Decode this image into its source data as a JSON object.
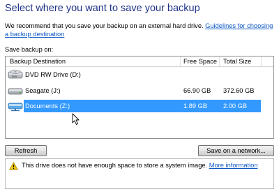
{
  "header": {
    "title": "Select where you want to save your backup",
    "intro_text": "We recommend that you save your backup on an external hard drive. ",
    "guidelines_link": "Guidelines for choosing a backup destination"
  },
  "save_label": "Save backup on:",
  "columns": {
    "destination": "Backup Destination",
    "free_space": "Free Space",
    "total_size": "Total Size"
  },
  "destinations": [
    {
      "name": "DVD RW Drive (D:)",
      "free": "",
      "total": "",
      "icon": "dvd-drive-icon"
    },
    {
      "name": "Seagate (J:)",
      "free": "66.90 GB",
      "total": "372.60 GB",
      "icon": "hard-drive-icon"
    },
    {
      "name": "Documents (Z:)",
      "free": "1.89 GB",
      "total": "2.00 GB",
      "icon": "network-drive-icon",
      "selected": true
    }
  ],
  "buttons": {
    "refresh": "Refresh",
    "save_network": "Save on a network..."
  },
  "message": {
    "text": "This drive does not have enough space to store a system image. ",
    "link": "More information",
    "icon": "warning-icon"
  },
  "colors": {
    "title": "#1e3287",
    "link": "#0b57c6",
    "selection": "#3399ff"
  }
}
